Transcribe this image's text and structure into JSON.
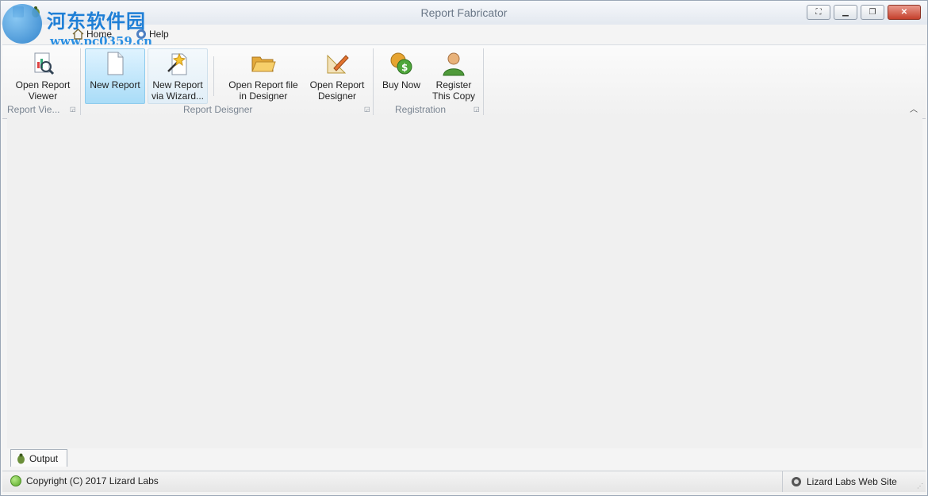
{
  "window": {
    "title": "Report Fabricator"
  },
  "watermark": {
    "cn_text": "河东软件园",
    "url": "www.pc0359.cn"
  },
  "tabs": [
    {
      "label": "Home",
      "icon": "home-icon"
    },
    {
      "label": "Help",
      "icon": "help-icon"
    }
  ],
  "ribbon": {
    "groups": [
      {
        "label": "Report Vie...",
        "buttons": [
          {
            "label1": "Open Report",
            "label2": "Viewer",
            "icon": "report-viewer-icon"
          }
        ]
      },
      {
        "label": "Report Deisgner",
        "buttons": [
          {
            "label1": "New Report",
            "label2": "",
            "icon": "new-document-icon"
          },
          {
            "label1": "New Report",
            "label2": "via Wizard...",
            "icon": "wizard-icon"
          },
          {
            "label1": "Open Report file",
            "label2": "in Designer",
            "icon": "folder-open-icon"
          },
          {
            "label1": "Open Report",
            "label2": "Designer",
            "icon": "designer-icon"
          }
        ]
      },
      {
        "label": "Registration",
        "buttons": [
          {
            "label1": "Buy Now",
            "label2": "",
            "icon": "coins-icon"
          },
          {
            "label1": "Register",
            "label2": "This Copy",
            "icon": "user-icon"
          }
        ]
      }
    ]
  },
  "output_tab": {
    "label": "Output",
    "icon": "bug-icon"
  },
  "status": {
    "copyright": "Copyright (C) 2017 Lizard Labs",
    "website": "Lizard Labs Web Site"
  },
  "colors": {
    "accent": "#a9dcf7",
    "close": "#c5402c",
    "status_ok": "#55a625"
  }
}
